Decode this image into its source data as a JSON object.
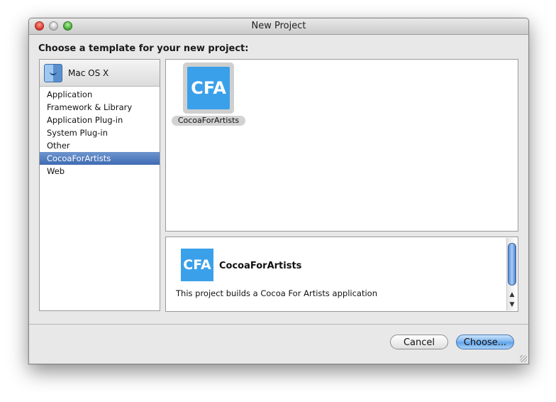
{
  "window": {
    "title": "New Project"
  },
  "heading": "Choose a template for your new project:",
  "sidebar": {
    "category": "Mac OS X",
    "items": [
      {
        "label": "Application"
      },
      {
        "label": "Framework & Library"
      },
      {
        "label": "Application Plug-in"
      },
      {
        "label": "System Plug-in"
      },
      {
        "label": "Other"
      },
      {
        "label": "CocoaForArtists",
        "selected": true
      },
      {
        "label": "Web"
      }
    ]
  },
  "templates": [
    {
      "icon_text": "CFA",
      "label": "CocoaForArtists",
      "selected": true
    }
  ],
  "description": {
    "icon_text": "CFA",
    "title": "CocoaForArtists",
    "text": "This project builds a Cocoa For Artists application"
  },
  "buttons": {
    "cancel": "Cancel",
    "choose": "Choose..."
  },
  "colors": {
    "selection": "#3e6bb2",
    "cfa_blue": "#3aa0ea"
  }
}
